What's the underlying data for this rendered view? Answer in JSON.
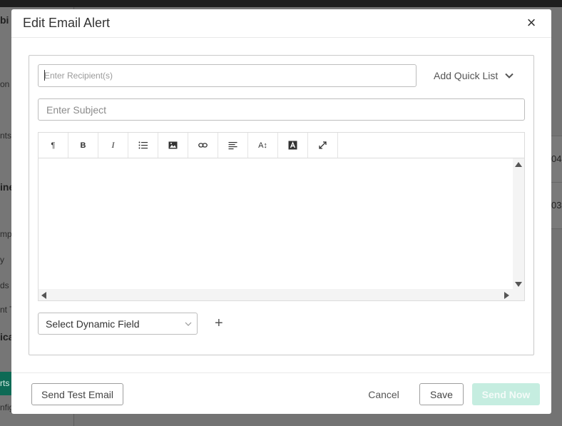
{
  "background": {
    "sidebar_fragments": [
      "bi",
      "on",
      "nts",
      "ine",
      "mpl",
      "y",
      "ds",
      "nt T",
      "ica",
      "rts",
      "nfig"
    ],
    "row_numbers": [
      "04",
      "03"
    ]
  },
  "modal": {
    "title": "Edit Email Alert",
    "close_icon": "close-icon",
    "recipient": {
      "placeholder": "Enter Recipient(s)",
      "value": ""
    },
    "quick_list": {
      "label": "Add Quick List",
      "icon": "chevron-down-icon"
    },
    "subject": {
      "placeholder": "Enter Subject",
      "value": ""
    },
    "editor": {
      "toolbar": [
        {
          "name": "paragraph-icon",
          "glyph": "¶"
        },
        {
          "name": "bold-icon",
          "glyph": "B"
        },
        {
          "name": "italic-icon",
          "glyph": "I"
        },
        {
          "name": "list-icon",
          "glyph": "list"
        },
        {
          "name": "image-icon",
          "glyph": "image"
        },
        {
          "name": "link-icon",
          "glyph": "link"
        },
        {
          "name": "align-icon",
          "glyph": "align"
        },
        {
          "name": "font-size-icon",
          "glyph": "A↕"
        },
        {
          "name": "font-color-icon",
          "glyph": "A"
        },
        {
          "name": "fullscreen-icon",
          "glyph": "expand"
        }
      ],
      "content": ""
    },
    "dynamic_field": {
      "selected": "Select Dynamic Field"
    },
    "add_field": "+",
    "footer": {
      "send_test": "Send Test Email",
      "cancel": "Cancel",
      "save": "Save",
      "send_now": "Send Now"
    }
  },
  "colors": {
    "accent_disabled": "#c5ede0",
    "sidebar_active": "#0e6a55"
  }
}
